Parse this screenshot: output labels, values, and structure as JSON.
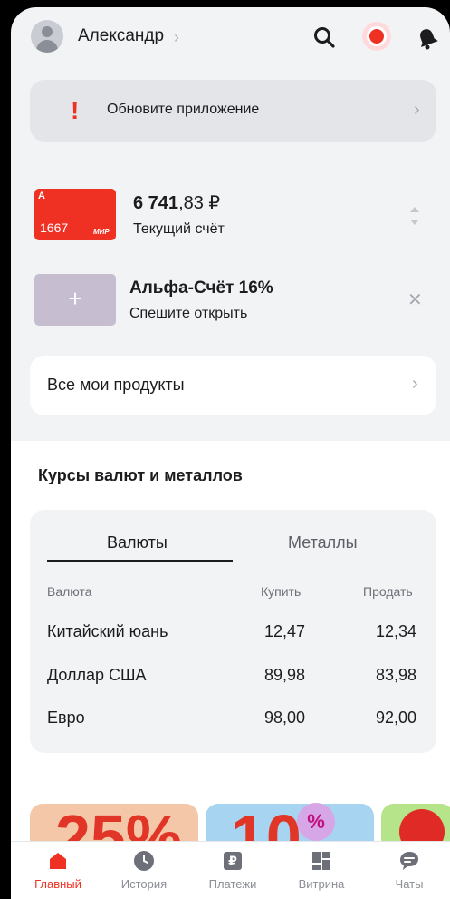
{
  "header": {
    "user_name": "Александр",
    "icons": [
      "avatar-icon",
      "search-icon",
      "record-icon",
      "bell-icon"
    ]
  },
  "update_banner": {
    "text": "Обновите приложение"
  },
  "account": {
    "card_last_digits": "1667",
    "card_brand": "МИР",
    "balance_int": "6 741",
    "balance_dec": ",83 ₽",
    "name": "Текущий счёт"
  },
  "promo_account": {
    "title": "Альфа-Счёт 16%",
    "subtitle": "Спешите открыть",
    "add_symbol": "+"
  },
  "all_products": {
    "label": "Все мои продукты"
  },
  "rates": {
    "title": "Курсы валют и металлов",
    "tabs": [
      "Валюты",
      "Металлы"
    ],
    "columns": [
      "Валюта",
      "Купить",
      "Продать"
    ],
    "rows": [
      {
        "name": "Китайский юань",
        "buy": "12,47",
        "sell": "12,34"
      },
      {
        "name": "Доллар США",
        "buy": "89,98",
        "sell": "83,98"
      },
      {
        "name": "Евро",
        "buy": "98,00",
        "sell": "92,00"
      }
    ]
  },
  "promos": {
    "badge": "%",
    "card1_text": "25%",
    "card2_text": "10"
  },
  "tabbar": [
    {
      "label": "Главный",
      "icon": "home-icon",
      "active": true
    },
    {
      "label": "История",
      "icon": "clock-icon",
      "active": false
    },
    {
      "label": "Платежи",
      "icon": "ruble-icon",
      "active": false
    },
    {
      "label": "Витрина",
      "icon": "grid-icon",
      "active": false
    },
    {
      "label": "Чаты",
      "icon": "chat-icon",
      "active": false
    }
  ],
  "colors": {
    "accent": "#ef3124",
    "background": "#f2f3f5"
  }
}
